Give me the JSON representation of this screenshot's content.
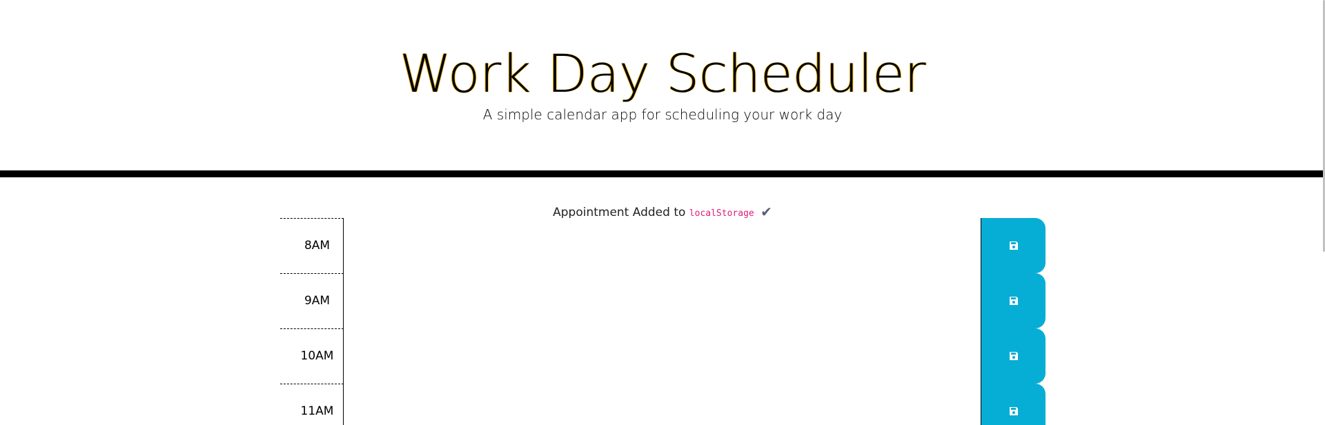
{
  "header": {
    "title": "Work Day Scheduler",
    "subtitle": "A simple calendar app for scheduling your work day"
  },
  "notification": {
    "text": "Appointment Added to",
    "code": "localStorage",
    "icon": "check-icon"
  },
  "time_blocks": [
    {
      "hour": "8AM",
      "description": ""
    },
    {
      "hour": "9AM",
      "description": ""
    },
    {
      "hour": "10AM",
      "description": ""
    },
    {
      "hour": "11AM",
      "description": ""
    }
  ],
  "colors": {
    "save_button": "#06aed5",
    "header_border": "#000000",
    "code_text": "#e01e7a"
  }
}
